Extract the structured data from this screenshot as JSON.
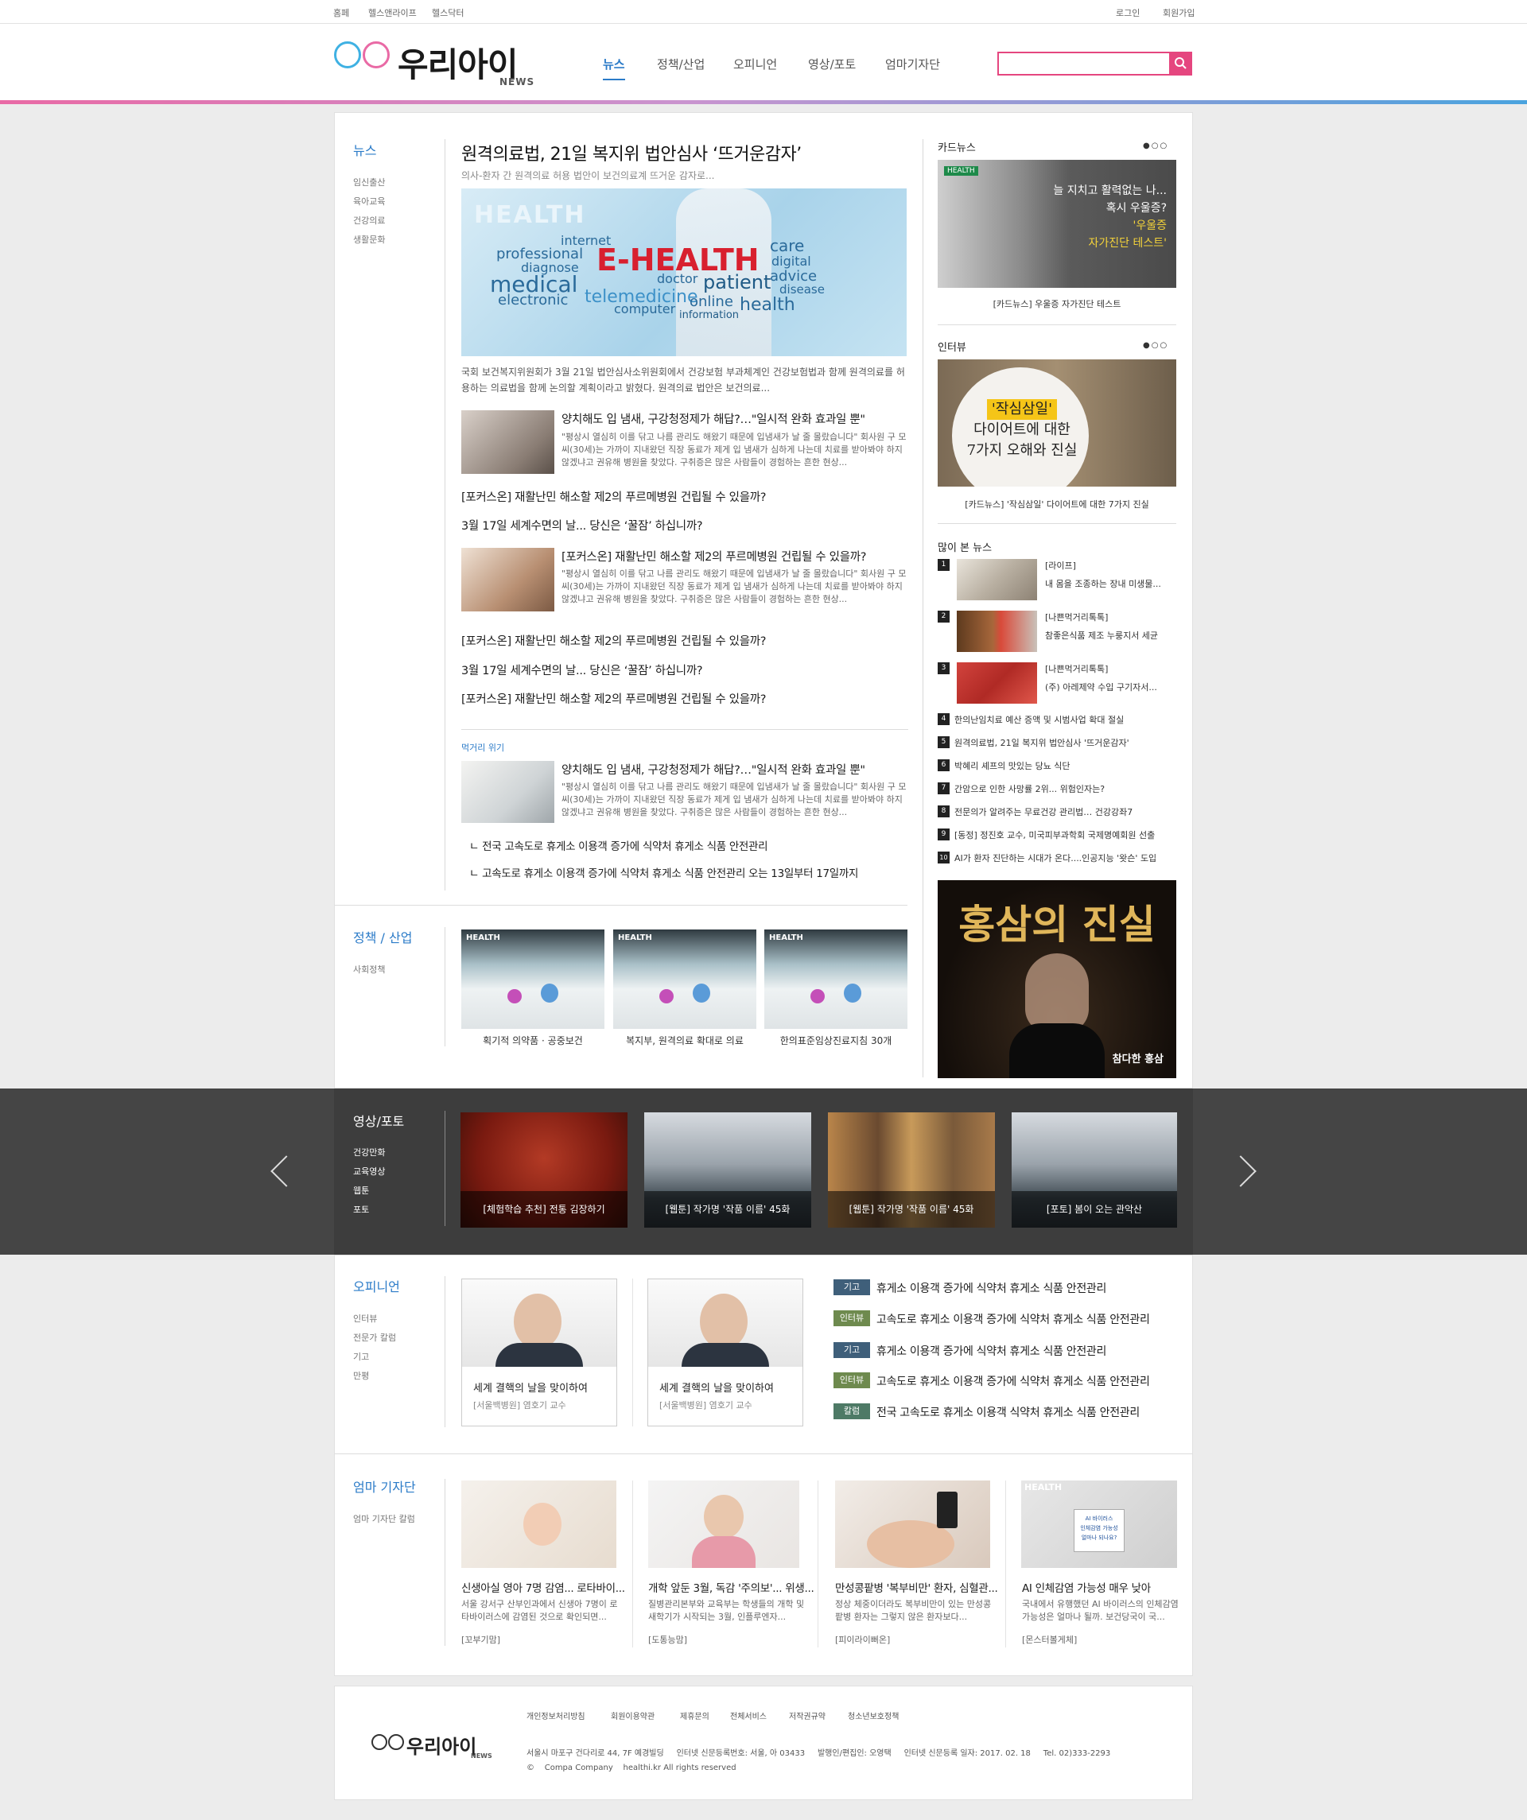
{
  "topbar": {
    "left": [
      "홈페",
      "헬스앤라이프",
      "헬스닥터"
    ],
    "right": [
      "로그인",
      "회원가입"
    ]
  },
  "logo": {
    "text": "우리아이",
    "sub": "NEWS"
  },
  "gnb": [
    "뉴스",
    "정책/산업",
    "오피니언",
    "영상/포토",
    "엄마기자단"
  ],
  "search": {
    "placeholder": ""
  },
  "news": {
    "section": "뉴스",
    "subs": [
      "임신출산",
      "육아교육",
      "건강의료",
      "생활문화"
    ],
    "headline": "원격의료법, 21일 복지위 법안심사 ‘뜨거운감자’",
    "lead": "의사-환자 간 원격의료 허용 법안이 보건의료계 뜨거운 감자로...",
    "hero_words": {
      "brand": "HEALTH",
      "main": "E-HEALTH",
      "w": [
        "internet",
        "professional",
        "diagnose",
        "medical",
        "electronic",
        "telemedicine",
        "doctor",
        "patient",
        "computer",
        "information",
        "online",
        "health",
        "care",
        "digital",
        "advice",
        "disease"
      ]
    },
    "para": "국회 보건복지위원회가 3월 21일 법안심사소위원회에서 건강보험 부과체계인 건강보험법과 함께 원격의료를 허용하는 의료법을 함께 논의할 계획이라고 밝혔다. 원격의료 법안은 보건의료...",
    "item1": {
      "title": "양치해도 입 냄새, 구강청정제가 해답?…\"일시적 완화 효과일 뿐\"",
      "body": "\"평상시 열심히 이를 닦고 나름 관리도 해왔기 때문에 입냄새가 날 줄 몰랐습니다\" 회사원 구 모 씨(30세)는 가까이 지내왔던 직장 동료가 제게 입 냄새가 심하게 나는데 치료를 받아봐야 하지 않겠냐고 권유해 병원을 찾았다. 구취증은 많은 사람들이 경험하는 흔한 현상..."
    },
    "lines1": [
      "[포커스온] 재활난민 해소할 제2의 푸르메병원 건립될 수 있을까?",
      "3월 17일 세계수면의 날... 당신은 ‘꿀잠’ 하십니까?"
    ],
    "item2": {
      "title": "[포커스온] 재활난민 해소할 제2의 푸르메병원 건립될 수 있을까?",
      "body": "\"평상시 열심히 이를 닦고 나름 관리도 해왔기 때문에 입냄새가 날 줄 몰랐습니다\" 회사원 구 모 씨(30세)는 가까이 지내왔던 직장 동료가 제게 입 냄새가 심하게 나는데 치료를 받아봐야 하지 않겠냐고 권유해 병원을 찾았다. 구취증은 많은 사람들이 경험하는 흔한 현상..."
    },
    "lines2": [
      "[포커스온] 재활난민 해소할 제2의 푸르메병원 건립될 수 있을까?",
      "3월 17일 세계수면의 날... 당신은 ‘꿀잠’ 하십니까?",
      "[포커스온] 재활난민 해소할 제2의 푸르메병원 건립될 수 있을까?"
    ],
    "sub_label": "먹거리 위기",
    "item3": {
      "title": "양치해도 입 냄새, 구강청정제가 해답?…\"일시적 완화 효과일 뿐\"",
      "body": "\"평상시 열심히 이를 닦고 나름 관리도 해왔기 때문에 입냄새가 날 줄 몰랐습니다\" 회사원 구 모 씨(30세)는 가까이 지내왔던 직장 동료가 제게 입 냄새가 심하게 나는데 치료를 받아봐야 하지 않겠냐고 권유해 병원을 찾았다. 구취증은 많은 사람들이 경험하는 흔한 현상..."
    },
    "related": [
      "전국 고속도로 휴게소 이용객 증가에 식약처 휴게소 식품 안전관리",
      "고속도로 휴게소 이용객 증가에 식약처 휴게소 식품 안전관리 오는 13일부터 17일까지"
    ]
  },
  "policy": {
    "section": "정책 / 산업",
    "subs": [
      "사회정책"
    ],
    "brand": "HEALTH",
    "items": [
      "획기적 의약품 · 공중보건",
      "복지부, 원격의료 확대로 의료",
      "한의표준임상진료지침 30개"
    ]
  },
  "card": {
    "title": "카드뉴스",
    "dots": "●○○",
    "img_text": [
      "늘 지치고 활력없는 나...",
      "혹시 우울증?",
      "'우울증",
      "자가진단 테스트'"
    ],
    "caption": "[카드뉴스] 우울증 자가진단 테스트",
    "brand": "HEALTH"
  },
  "interview": {
    "title": "인터뷰",
    "dots": "●○○",
    "img_text": [
      "'작심삼일'",
      "다이어트에 대한",
      "7가지 오해와 진실"
    ],
    "caption": "[카드뉴스] '작심삼일' 다이어트에 대한 7가지 진실"
  },
  "popular": {
    "title": "많이 본 뉴스",
    "top": [
      {
        "n": "1",
        "cat": "[라이프]",
        "t": "내 몸을 조종하는 장내 미생물..."
      },
      {
        "n": "2",
        "cat": "[나쁜먹거리톡톡]",
        "t": "참좋은식품 제조 누룽지서 세균"
      },
      {
        "n": "3",
        "cat": "[나쁜먹거리톡톡]",
        "t": "(주) 아레제약 수입 구기자서..."
      }
    ],
    "list": [
      {
        "n": "4",
        "t": "한의난임치료 예산 증액 및 시범사업 확대 절실"
      },
      {
        "n": "5",
        "t": "원격의료법, 21일 복지위 법안심사 '뜨거운감자'"
      },
      {
        "n": "6",
        "t": "박혜리 셰프의 맛있는 당뇨 식단"
      },
      {
        "n": "7",
        "t": "간암으로 인한 사망률 2위... 위험인자는?"
      },
      {
        "n": "8",
        "t": "전문의가 알려주는 무료건강 관리법… 건강강좌7"
      },
      {
        "n": "9",
        "t": "[동정] 정진호 교수, 미국피부과학회 국제명예회원 선출"
      },
      {
        "n": "10",
        "t": "AI가 환자 진단하는 시대가 온다....인공지능 '왓슨' 도입"
      }
    ]
  },
  "ad": {
    "title": "홍삼의 진실",
    "brand": "참다한 홍삼"
  },
  "video": {
    "section": "영상/포토",
    "subs": [
      "건강만화",
      "교육영상",
      "웹툰",
      "포토"
    ],
    "items": [
      "[체험학습 추천] 전통 김장하기",
      "[웹툰] 작가명 '작품 이름' 45화",
      "[웹툰] 작가명 '작품 이름' 45화",
      "[포토] 봄이 오는 관악산"
    ]
  },
  "opinion": {
    "section": "오피니언",
    "subs": [
      "인터뷰",
      "전문가 칼럼",
      "기고",
      "만평"
    ],
    "cards": [
      {
        "title": "세계 결핵의 날을 맞이하여",
        "by": "[서울백병원] 염호기 교수"
      },
      {
        "title": "세계 결핵의 날을 맞이하여",
        "by": "[서울백병원] 염호기 교수"
      }
    ],
    "list": [
      {
        "tag": "기고",
        "color": "#3f5f7a",
        "t": "휴게소 이용객 증가에 식약처 휴게소 식품 안전관리"
      },
      {
        "tag": "인터뷰",
        "color": "#6e8a4e",
        "t": "고속도로 휴게소 이용객 증가에 식약처 휴게소 식품 안전관리"
      },
      {
        "tag": "기고",
        "color": "#3f5f7a",
        "t": "휴게소 이용객 증가에 식약처 휴게소 식품 안전관리"
      },
      {
        "tag": "인터뷰",
        "color": "#6e8a4e",
        "t": "고속도로 휴게소 이용객 증가에 식약처 휴게소 식품 안전관리"
      },
      {
        "tag": "칼럼",
        "color": "#4e7a66",
        "t": "전국 고속도로 휴게소 이용객 식약처 휴게소 식품 안전관리"
      }
    ]
  },
  "mom": {
    "section": "엄마 기자단",
    "subs": [
      "엄마 기자단 칼럼"
    ],
    "brand": "HEALTH",
    "sign": [
      "AI 바이러스",
      "인체감염 가능성",
      "얼마나 되나요?"
    ],
    "items": [
      {
        "title": "신생아실 영아 7명 감염... 로타바이...",
        "body": "서울 강서구 산부인과에서 신생아 7명이 로타바이러스에 감염된 것으로 확인되면...",
        "by": "[꼬부기맘]"
      },
      {
        "title": "개학 앞둔 3월, 독감 '주의보'... 위생...",
        "body": "질병관리본부와 교육부는 학생들의 개학 및 새학기가 시작되는 3월, 인플루엔자...",
        "by": "[도통능맘]"
      },
      {
        "title": "만성콩팥병 '복부비만' 환자, 심혈관...",
        "body": "정상 체중이더라도 복부비만이 있는 만성콩팥병 환자는 그렇지 않은 환자보다...",
        "by": "[피이라이뻐온]"
      },
      {
        "title": "AI 인체감염 가능성 매우 낮아",
        "body": "국내에서 유행했던 AI 바이러스의 인체감염 가능성은 얼마나 될까. 보건당국이 국...",
        "by": "[몬스터볼게체]"
      }
    ]
  },
  "footer": {
    "logo": "우리아이",
    "logo_sub": "NEWS",
    "links": [
      "개인정보처리방침",
      "회원이용약관",
      "제휴문의",
      "전체서비스",
      "저작권규약",
      "청소년보호정책"
    ],
    "address": "서울시 마포구 건다리로 44, 7F 예경빌딩     인터넷 신문등록번호: 서울, 아 03433     발행인/편집인: 오영택     인터넷 신문등록 일자: 2017. 02. 18     Tel. 02)333-2293",
    "copy": "©    Compa Company    healthi.kr All rights reserved"
  },
  "colors": {
    "accent": "#2b7bc8",
    "pink": "#e5467f",
    "dark_band": "#454545"
  }
}
